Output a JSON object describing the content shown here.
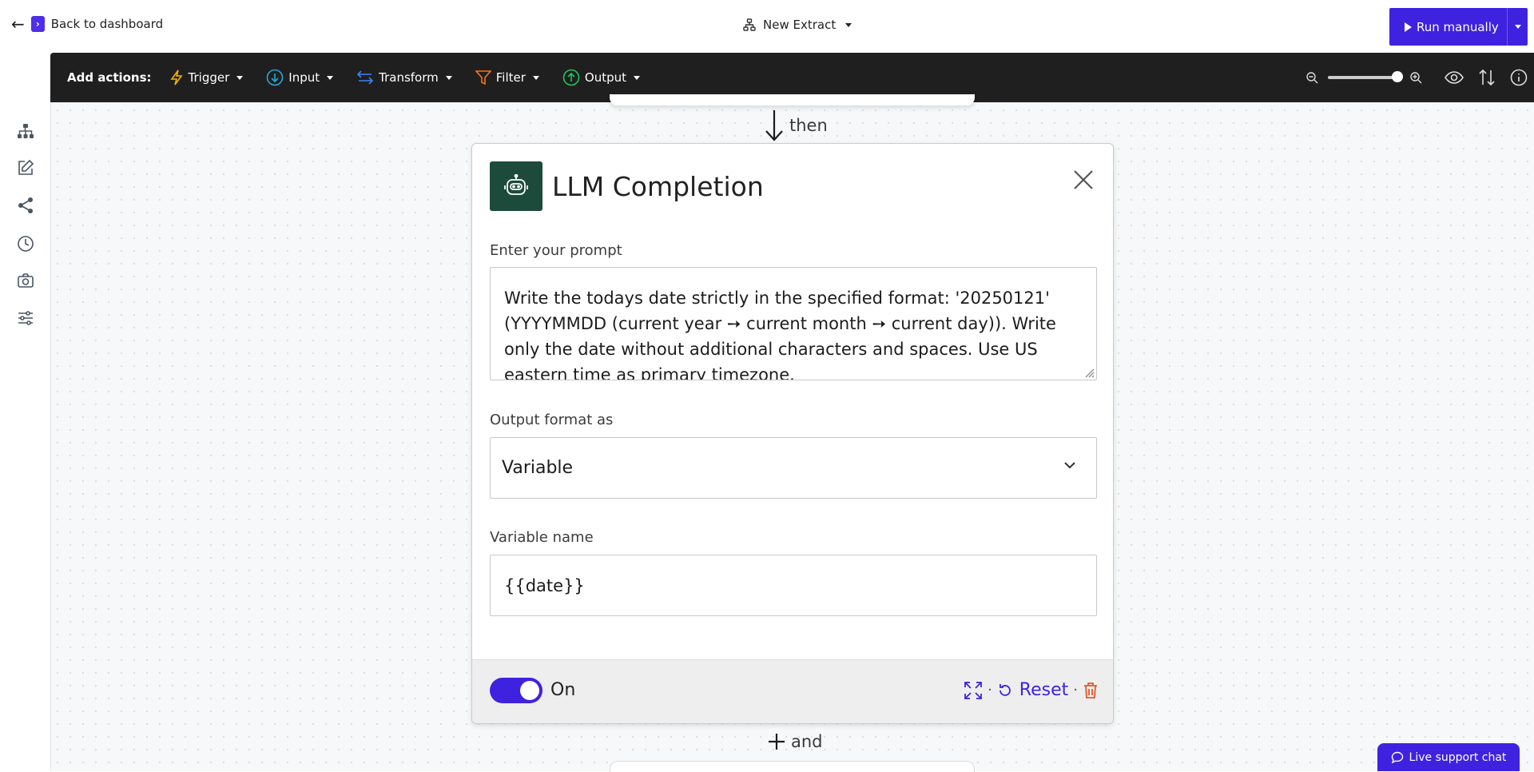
{
  "header": {
    "back_label": "Back to dashboard",
    "project_name": "New Extract",
    "run_label": "Run manually"
  },
  "toolbar": {
    "add_actions_label": "Add actions:",
    "items": [
      {
        "label": "Trigger",
        "icon": "lightning-icon",
        "color": "#f5b301"
      },
      {
        "label": "Input",
        "icon": "arrow-down-circle-icon",
        "color": "#2aa7d8"
      },
      {
        "label": "Transform",
        "icon": "swap-arrows-icon",
        "color": "#3b82f6"
      },
      {
        "label": "Filter",
        "icon": "funnel-icon",
        "color": "#f97316"
      },
      {
        "label": "Output",
        "icon": "arrow-up-circle-icon",
        "color": "#22c55e"
      }
    ],
    "zoom_level": 1.0
  },
  "sidebar": {
    "icons": [
      "hierarchy-icon",
      "edit-icon",
      "share-icon",
      "history-icon",
      "camera-icon",
      "sliders-icon"
    ]
  },
  "flow": {
    "connector_top": "then",
    "connector_bottom": "and"
  },
  "node": {
    "title": "LLM Completion",
    "prompt_label": "Enter your prompt",
    "prompt_value": "Write the todays date strictly in the specified format: '20250121' (YYYYMMDD (current year ➙ current month ➙ current day)). Write only the date without additional characters and spaces. Use US eastern time as primary timezone.",
    "output_format_label": "Output format as",
    "output_format_value": "Variable",
    "variable_label": "Variable name",
    "variable_value": "{{date}}",
    "toggle_label": "On",
    "toggle_on": true,
    "reset_label": "Reset"
  },
  "colors": {
    "accent": "#3f22e0",
    "toolbar_bg": "#1f1f1f",
    "node_icon_bg": "#1c4a3b",
    "delete": "#e0592a"
  },
  "support": {
    "label": "Live support chat"
  }
}
